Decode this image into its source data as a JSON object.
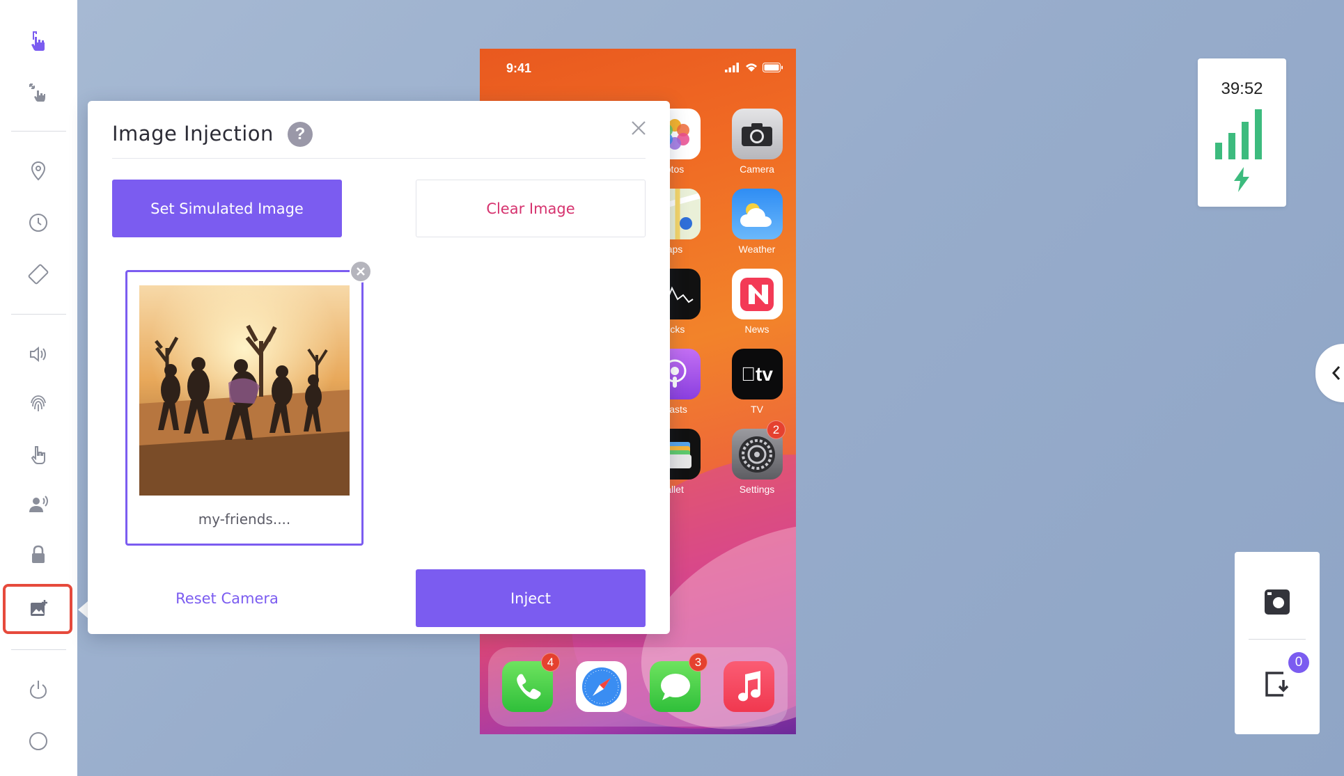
{
  "sidebar": {
    "items": [
      {
        "icon": "tap-hand-icon"
      },
      {
        "icon": "pinch-zoom-icon"
      },
      {
        "icon": "location-pin-icon"
      },
      {
        "icon": "clock-icon"
      },
      {
        "icon": "rotate-device-icon"
      },
      {
        "icon": "volume-icon"
      },
      {
        "icon": "fingerprint-icon"
      },
      {
        "icon": "touch-hand-icon"
      },
      {
        "icon": "voice-user-icon"
      },
      {
        "icon": "lock-icon"
      },
      {
        "icon": "image-injection-icon",
        "active": true
      },
      {
        "icon": "power-icon"
      },
      {
        "icon": "home-circle-icon"
      }
    ],
    "active_color": "#e64a3c"
  },
  "modal": {
    "title": "Image Injection",
    "help_symbol": "?",
    "set_image_label": "Set Simulated Image",
    "clear_image_label": "Clear Image",
    "thumbnail_name": "my-friends....",
    "reset_camera_label": "Reset Camera",
    "inject_label": "Inject",
    "accent_color": "#7b5cf0",
    "danger_color": "#d6326e"
  },
  "phone": {
    "status_time": "9:41",
    "apps": [
      {
        "label": "Photos",
        "visible_label": "otos"
      },
      {
        "label": "Camera",
        "visible_label": "Camera"
      },
      {
        "label": "Maps",
        "visible_label": "aps"
      },
      {
        "label": "Weather",
        "visible_label": "Weather"
      },
      {
        "label": "Stocks",
        "visible_label": "ocks"
      },
      {
        "label": "News",
        "visible_label": "News"
      },
      {
        "label": "Podcasts",
        "visible_label": "lcasts"
      },
      {
        "label": "TV",
        "visible_label": "TV",
        "glyph": "tv"
      },
      {
        "label": "Wallet",
        "visible_label": "allet"
      },
      {
        "label": "Settings",
        "visible_label": "Settings",
        "badge": "2"
      }
    ],
    "dock": [
      {
        "label": "Phone",
        "badge": "4"
      },
      {
        "label": "Safari"
      },
      {
        "label": "Messages",
        "badge": "3"
      },
      {
        "label": "Music"
      }
    ]
  },
  "stats": {
    "timer": "39:52",
    "signal_color": "#3dbb7e"
  },
  "tools": {
    "badge": "0"
  }
}
